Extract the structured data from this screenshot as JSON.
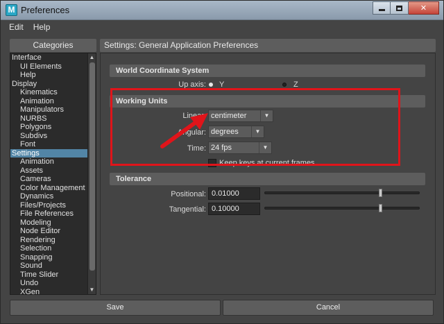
{
  "window": {
    "title": "Preferences",
    "logo_letter": "M",
    "controls": [
      "minimize",
      "maximize",
      "close"
    ],
    "close_glyph": "✕"
  },
  "menu": [
    {
      "label": "Edit"
    },
    {
      "label": "Help"
    }
  ],
  "categories": {
    "header": "Categories",
    "items": [
      {
        "label": "Interface",
        "level": 0
      },
      {
        "label": "UI Elements",
        "level": 1
      },
      {
        "label": "Help",
        "level": 1
      },
      {
        "label": "Display",
        "level": 0
      },
      {
        "label": "Kinematics",
        "level": 1
      },
      {
        "label": "Animation",
        "level": 1
      },
      {
        "label": "Manipulators",
        "level": 1
      },
      {
        "label": "NURBS",
        "level": 1
      },
      {
        "label": "Polygons",
        "level": 1
      },
      {
        "label": "Subdivs",
        "level": 1
      },
      {
        "label": "Font",
        "level": 1
      },
      {
        "label": "Settings",
        "level": 0,
        "selected": true
      },
      {
        "label": "Animation",
        "level": 1
      },
      {
        "label": "Assets",
        "level": 1
      },
      {
        "label": "Cameras",
        "level": 1
      },
      {
        "label": "Color Management",
        "level": 1
      },
      {
        "label": "Dynamics",
        "level": 1
      },
      {
        "label": "Files/Projects",
        "level": 1
      },
      {
        "label": "File References",
        "level": 1
      },
      {
        "label": "Modeling",
        "level": 1
      },
      {
        "label": "Node Editor",
        "level": 1
      },
      {
        "label": "Rendering",
        "level": 1
      },
      {
        "label": "Selection",
        "level": 1
      },
      {
        "label": "Snapping",
        "level": 1
      },
      {
        "label": "Sound",
        "level": 1
      },
      {
        "label": "Time Slider",
        "level": 1
      },
      {
        "label": "Undo",
        "level": 1
      },
      {
        "label": "XGen",
        "level": 1
      }
    ],
    "scroll_up_glyph": "▲",
    "scroll_down_glyph": "▼"
  },
  "settings": {
    "header": "Settings: General Application Preferences",
    "world_coordinate": {
      "title": "World Coordinate System",
      "up_axis_label": "Up axis:",
      "options": [
        {
          "label": "Y",
          "selected": true
        },
        {
          "label": "Z",
          "selected": false
        }
      ]
    },
    "working_units": {
      "title": "Working Units",
      "linear_label": "Linear:",
      "linear_value": "centimeter",
      "angular_label": "Angular:",
      "angular_value": "degrees",
      "time_label": "Time:",
      "time_value": "24 fps",
      "keep_keys_label": "Keep keys at current frames",
      "keep_keys_checked": false
    },
    "tolerance": {
      "title": "Tolerance",
      "positional_label": "Positional:",
      "positional_value": "0.01000",
      "positional_slider": 0.01,
      "tangential_label": "Tangential:",
      "tangential_value": "0.10000",
      "tangential_slider": 0.01
    },
    "dropdown_arrow_glyph": "▼"
  },
  "buttons": {
    "save": "Save",
    "cancel": "Cancel"
  },
  "annotation": {
    "color": "#e0141a"
  }
}
